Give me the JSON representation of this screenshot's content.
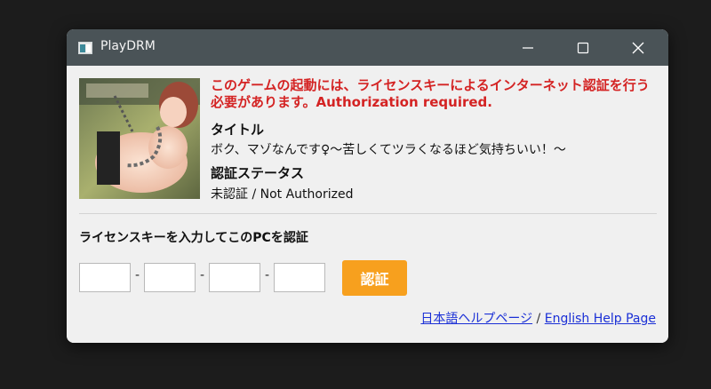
{
  "window": {
    "title": "PlayDRM"
  },
  "main": {
    "warning": "このゲームの起動には、ライセンスキーによるインターネット認証を行う必要があります。Authorization required.",
    "title_label": "タイトル",
    "title_value": "ボク、マゾなんです♀～苦しくてツラくなるほど気持ちいい！～",
    "status_label": "認証ステータス",
    "status_value": "未認証 / Not Authorized"
  },
  "license": {
    "prompt": "ライセンスキーを入力してこのPCを認証",
    "fields": [
      "",
      "",
      "",
      ""
    ],
    "separator": "-",
    "button_label": "認証"
  },
  "help": {
    "jp_link": "日本語ヘルプページ",
    "divider": " / ",
    "en_link": "English Help Page"
  },
  "colors": {
    "titlebar": "#4a5357",
    "warning": "#d42323",
    "button": "#f7a01e",
    "link": "#1a2fd6"
  }
}
